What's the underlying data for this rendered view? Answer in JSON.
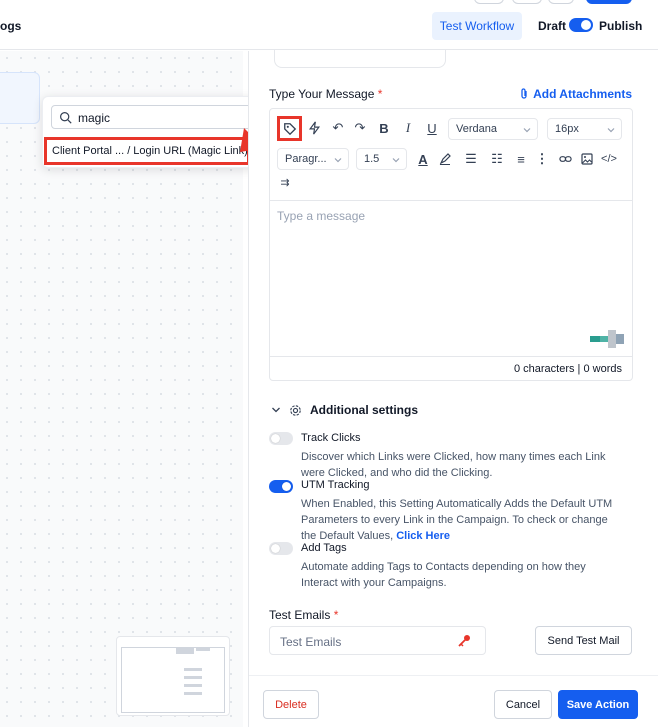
{
  "topbar": {
    "left_tab": "ogs",
    "test_workflow": "Test Workflow",
    "draft": "Draft",
    "publish": "Publish"
  },
  "search": {
    "value": "magic",
    "result": "Client Portal ... / Login URL (Magic Link)"
  },
  "message": {
    "label": "Type Your Message",
    "required_mark": "*",
    "add_attachments": "Add Attachments",
    "font_family": "Verdana",
    "font_size": "16px",
    "paragraph": "Paragr...",
    "line_height": "1.5",
    "placeholder": "Type a message",
    "characters": "0 characters",
    "separator": "|",
    "words": "0 words"
  },
  "additional_settings": {
    "title": "Additional settings",
    "track_clicks": {
      "title": "Track Clicks",
      "enabled": false,
      "desc": "Discover which Links were Clicked, how many times each Link were Clicked, and who did the Clicking."
    },
    "utm_tracking": {
      "title": "UTM Tracking",
      "enabled": true,
      "desc": "When Enabled, this Setting Automatically Adds the Default UTM Parameters to every Link in the Campaign. To check or change the Default Values,",
      "link": "Click Here"
    },
    "add_tags": {
      "title": "Add Tags",
      "enabled": false,
      "desc": "Automate adding Tags to Contacts depending on how they Interact with your Campaigns."
    }
  },
  "test_emails": {
    "label": "Test Emails",
    "required_mark": "*",
    "placeholder": "Test Emails",
    "send_button": "Send Test Mail"
  },
  "footer": {
    "delete": "Delete",
    "cancel": "Cancel",
    "save": "Save Action"
  },
  "colors": {
    "accent": "#155eef",
    "highlight_red": "#e8352a",
    "danger": "#d92d20"
  },
  "icons": [
    "tag-icon",
    "flash-icon",
    "undo-icon",
    "redo-icon",
    "bold-icon",
    "italic-icon",
    "underline-icon",
    "text-color-icon",
    "highlight-icon",
    "bullet-list-icon",
    "numbered-list-icon",
    "align-icon",
    "more-icon",
    "link-icon",
    "image-icon",
    "code-icon",
    "indent-icon",
    "search-icon",
    "attachment-icon",
    "gear-icon",
    "chevron-down-icon",
    "key-icon"
  ]
}
